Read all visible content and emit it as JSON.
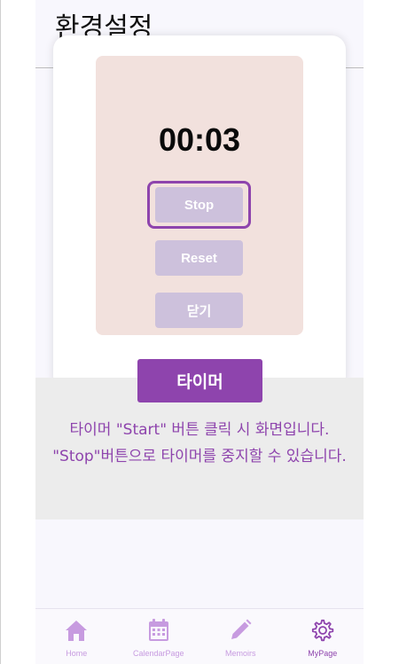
{
  "header": {
    "title": "환경설정"
  },
  "timer": {
    "display": "00:03",
    "buttons": {
      "stop": "Stop",
      "reset": "Reset",
      "close": "닫기"
    }
  },
  "guide": {
    "badge": "타이머",
    "description": "타이머 \"Start\" 버튼 클릭 시 화면입니다. \"Stop\"버튼으로 타이머를 중지할 수 있습니다."
  },
  "bottom_nav": {
    "items": [
      {
        "label": "Home",
        "icon": "home-icon"
      },
      {
        "label": "CalendarPage",
        "icon": "calendar-icon"
      },
      {
        "label": "Memoirs",
        "icon": "pencil-icon"
      },
      {
        "label": "MyPage",
        "icon": "gear-icon"
      }
    ],
    "active": "MyPage"
  },
  "colors": {
    "accent": "#8e44ad",
    "nav_inactive": "#c79be0",
    "timer_panel": "#f2e1dd",
    "timer_button": "#cdc1dc",
    "guide_box": "#ececec"
  }
}
